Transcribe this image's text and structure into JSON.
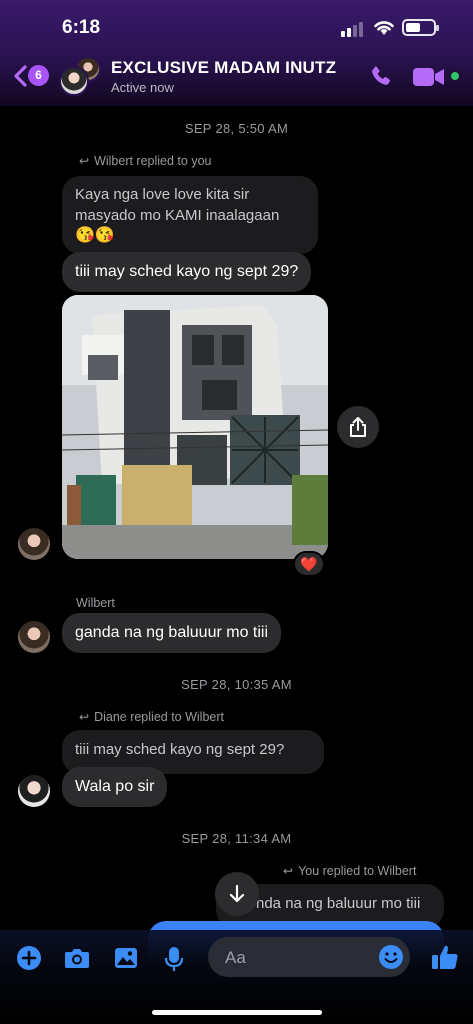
{
  "status_bar": {
    "time": "6:18"
  },
  "header": {
    "back_badge": "6",
    "name": "EXCLUSIVE MADAM INUTZ",
    "subtitle": "Active now"
  },
  "timestamps": [
    "SEP 28, 5:50 AM",
    "SEP 28, 10:35 AM",
    "SEP 28, 11:34 AM"
  ],
  "messages": {
    "reply_note_1": "Wilbert replied to you",
    "quoted_1_line1": "Kaya nga love love kita sir",
    "quoted_1_line2": "masyado mo KAMI inaalagaan",
    "quoted_1_emoji": "😘😘",
    "msg_1": "tiii may sched kayo ng sept 29?",
    "reaction": "❤️",
    "sender_2": "Wilbert",
    "msg_2": "ganda na ng baluuur mo tiii",
    "reply_note_3": "Diane replied to Wilbert",
    "quoted_3": "tiii may sched kayo ng sept 29?",
    "msg_3": "Wala po sir",
    "reply_note_4": "You replied to Wilbert",
    "quoted_4": "nda na ng baluuur mo tiii"
  },
  "composer": {
    "placeholder": "Aa"
  },
  "colors": {
    "accent": "#a855f7",
    "online": "#31c56a",
    "outgoing": "#3b82f6",
    "composer_icons": "#3b8cf5"
  }
}
